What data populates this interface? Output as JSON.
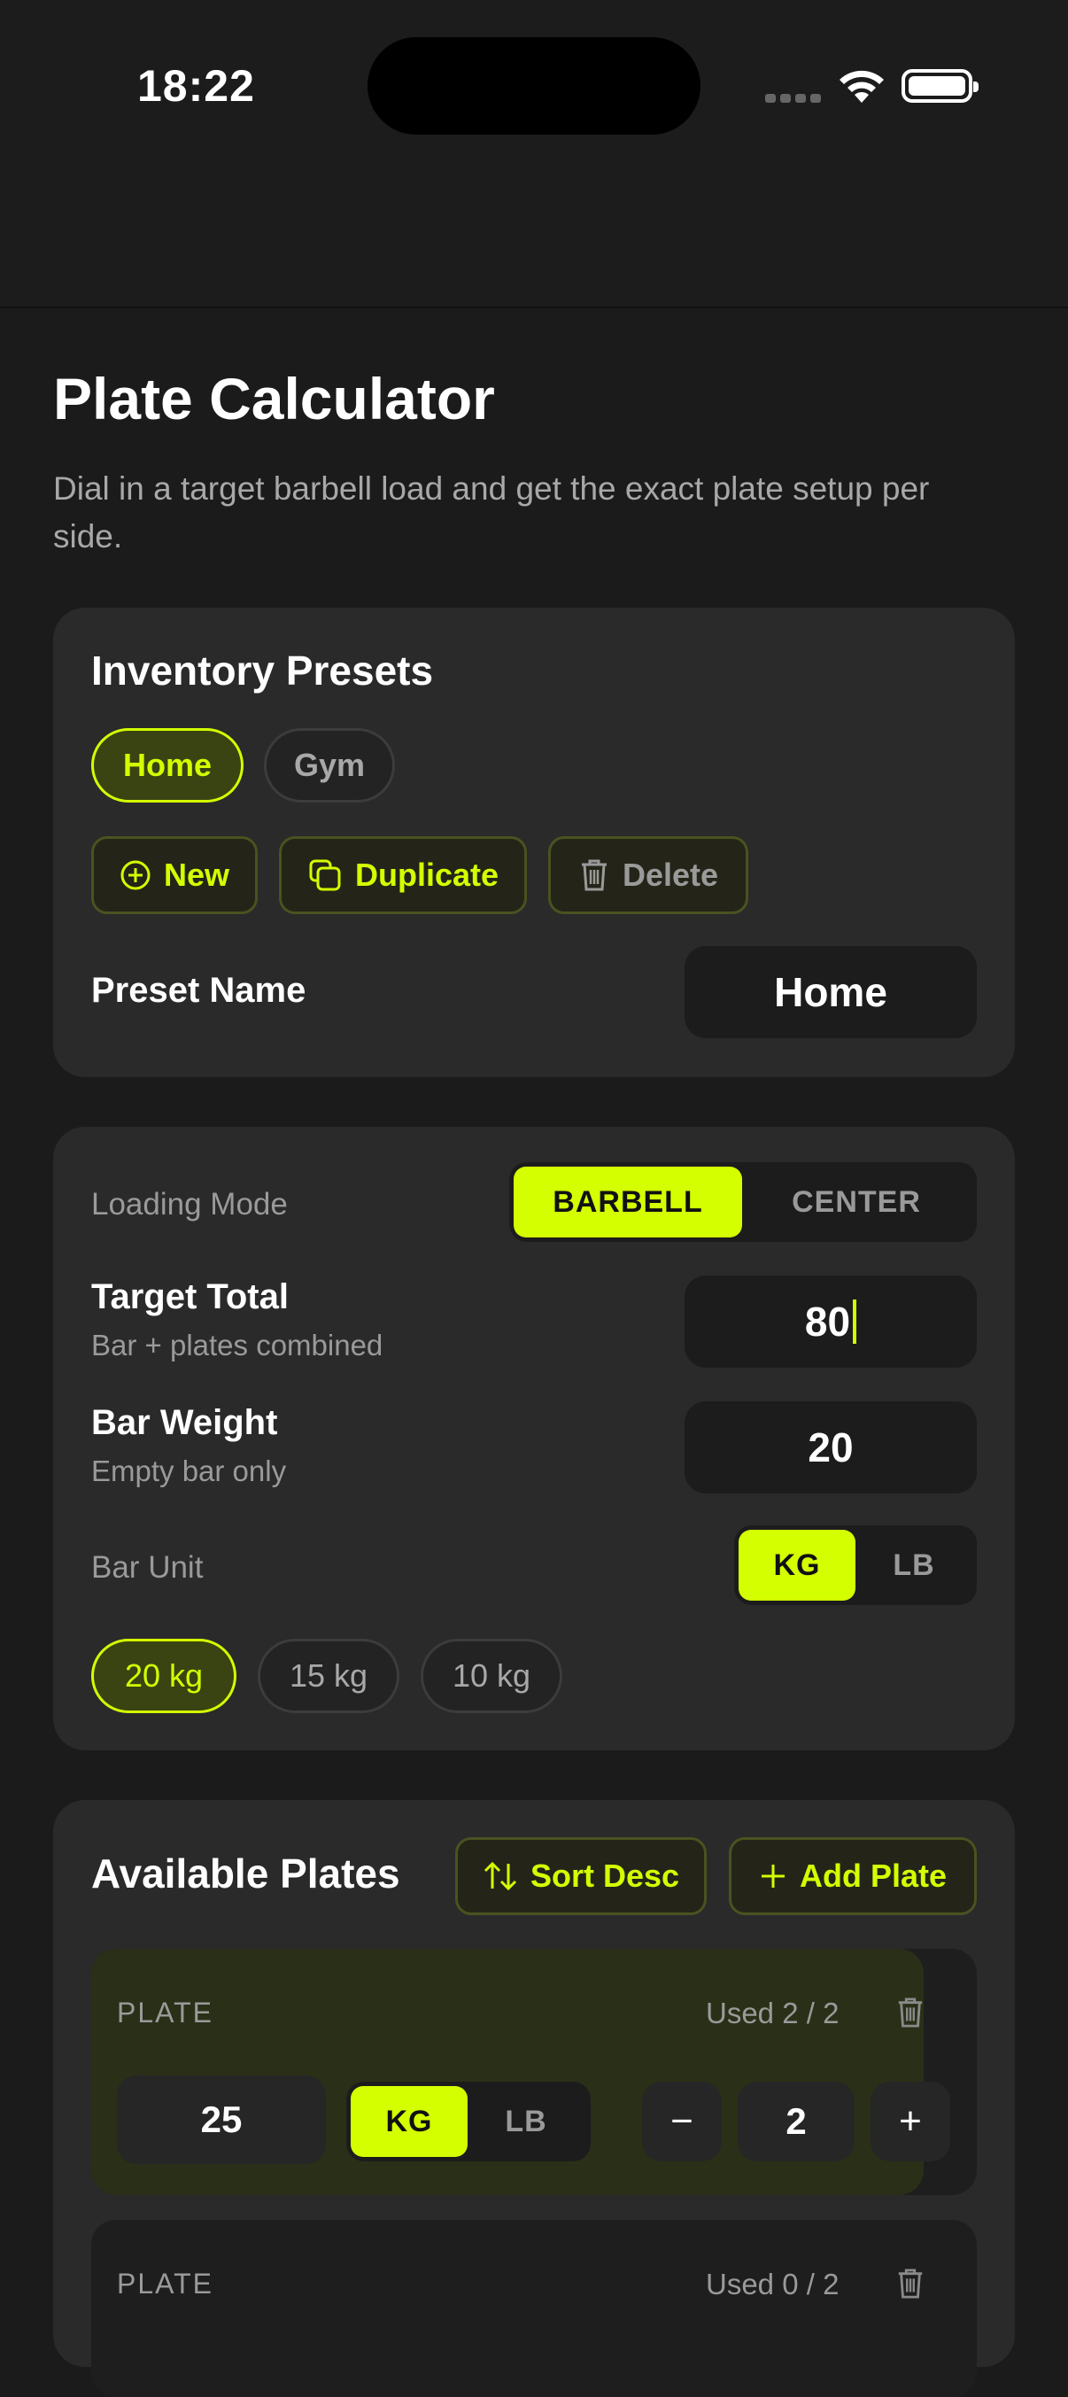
{
  "status": {
    "time": "18:22"
  },
  "header": {
    "title": "Plate Calculator",
    "subtitle": "Dial in a target barbell load and get the exact plate setup per side."
  },
  "presets": {
    "title": "Inventory Presets",
    "chips": [
      "Home",
      "Gym"
    ],
    "selected": "Home",
    "new_label": "New",
    "duplicate_label": "Duplicate",
    "delete_label": "Delete",
    "name_label": "Preset Name",
    "name_value": "Home"
  },
  "loading": {
    "mode_label": "Loading Mode",
    "mode_options": [
      "BARBELL",
      "CENTER"
    ],
    "mode_selected": "BARBELL",
    "target_label": "Target Total",
    "target_hint": "Bar + plates combined",
    "target_value": "80",
    "bar_label": "Bar Weight",
    "bar_hint": "Empty bar only",
    "bar_value": "20",
    "unit_label": "Bar Unit",
    "unit_options": [
      "KG",
      "LB"
    ],
    "unit_selected": "KG",
    "bar_chips": [
      "20 kg",
      "15 kg",
      "10 kg"
    ],
    "bar_selected": "20 kg"
  },
  "plates": {
    "title": "Available Plates",
    "sort_label": "Sort Desc",
    "add_label": "Add Plate",
    "rows": [
      {
        "label": "PLATE",
        "used": "Used 2 / 2",
        "weight": "25",
        "unit_options": [
          "KG",
          "LB"
        ],
        "unit_selected": "KG",
        "count": "2",
        "fill": 0.94
      },
      {
        "label": "PLATE",
        "used": "Used 0 / 2"
      }
    ],
    "minus": "−",
    "plus": "+"
  },
  "colors": {
    "accent": "#d4ff00",
    "background": "#1b1b1b",
    "card": "#2a2a2a"
  }
}
